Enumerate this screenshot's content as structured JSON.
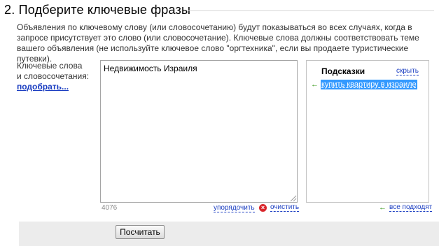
{
  "section": {
    "title": "2. Подберите ключевые фразы"
  },
  "description": "Объявления по ключевому слову (или словосочетанию) будут показываться во всех случаях, когда в запросе присутствует это слово (или словосочетание). Ключевые слова должны соответствовать теме вашего объявления (не используйте ключевое слово \"оргтехника\", если вы продаете туристические путевки).",
  "keywords": {
    "label_line1": "Ключевые слова",
    "label_line2": "и словосочетания:",
    "pick_link": "подобрать...",
    "value": "Недвижимость Израиля",
    "char_count": "4076",
    "sort_link": "упорядочить",
    "clear_link": "очистить",
    "clear_icon": "close-circle-icon"
  },
  "hints": {
    "title": "Подсказки",
    "hide_link": "скрыть",
    "items": [
      {
        "label": "купить квартиру в израиле",
        "icon": "arrow-left-icon"
      }
    ],
    "all_fit_link": "все подходят",
    "all_fit_icon": "arrow-left-icon"
  },
  "actions": {
    "count_button": "Посчитать"
  },
  "colors": {
    "link": "#1a3dc1",
    "highlight": "#3399ff",
    "arrow_green": "#3a9a1d",
    "clear_red": "#d9252a",
    "bottom_bar": "#ececec"
  }
}
